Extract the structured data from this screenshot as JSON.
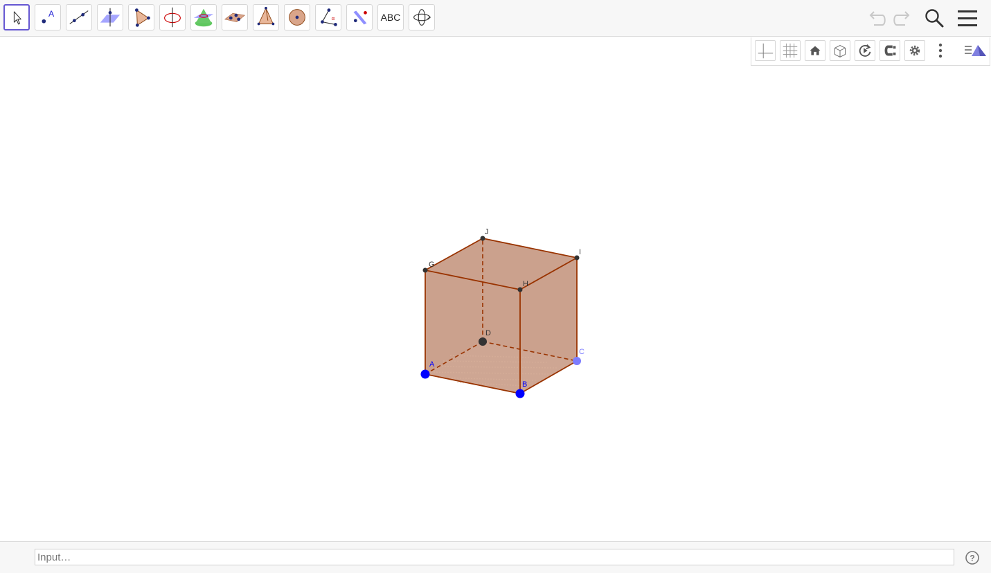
{
  "toolbar": {
    "tools": [
      {
        "name": "move-tool",
        "icon": "arrow-cursor-icon"
      },
      {
        "name": "point-tool",
        "icon": "point-icon",
        "label": "A"
      },
      {
        "name": "line-tool",
        "icon": "line-icon"
      },
      {
        "name": "perpendicular-line-tool",
        "icon": "perpendicular-line-icon"
      },
      {
        "name": "polygon-tool",
        "icon": "triangle-icon"
      },
      {
        "name": "circle-axis-tool",
        "icon": "circle-axis-icon"
      },
      {
        "name": "intersect-surfaces-tool",
        "icon": "cone-plane-icon"
      },
      {
        "name": "plane-tool",
        "icon": "plane-points-icon"
      },
      {
        "name": "pyramid-tool",
        "icon": "pyramid-icon"
      },
      {
        "name": "sphere-tool",
        "icon": "sphere-icon"
      },
      {
        "name": "angle-tool",
        "icon": "angle-icon"
      },
      {
        "name": "reflect-tool",
        "icon": "reflect-plane-icon"
      },
      {
        "name": "text-tool",
        "icon": "text-icon",
        "label": "ABC"
      },
      {
        "name": "rotate-view-tool",
        "icon": "rotate-view-icon"
      }
    ],
    "undo_icon": "undo-icon",
    "redo_icon": "redo-icon",
    "search_icon": "search-icon",
    "menu_icon": "menu-icon"
  },
  "stylebar": {
    "buttons": [
      "axes-icon",
      "grid-icon",
      "home-icon",
      "cube-view-icon",
      "rotate-icon",
      "clipping-icon",
      "gear-icon",
      "more-icon",
      "toggle-style-bar-icon"
    ]
  },
  "graphics": {
    "points": [
      {
        "name": "A",
        "label": "A",
        "color": "#0000ff"
      },
      {
        "name": "B",
        "label": "B",
        "color": "#0000ff"
      },
      {
        "name": "C",
        "label": "C",
        "color": "#7d7dff"
      },
      {
        "name": "D",
        "label": "D",
        "color": "#333333"
      },
      {
        "name": "G",
        "label": "G",
        "color": "#333333"
      },
      {
        "name": "H",
        "label": "H",
        "color": "#333333"
      },
      {
        "name": "I",
        "label": "I",
        "color": "#333333"
      },
      {
        "name": "J",
        "label": "J",
        "color": "#333333"
      }
    ],
    "colors": {
      "face_fill": "#a0522d",
      "edge": "#993300",
      "selected_border": "#6557d2"
    }
  },
  "input_bar": {
    "placeholder": "Input…",
    "value": "",
    "help_icon": "help-icon"
  }
}
